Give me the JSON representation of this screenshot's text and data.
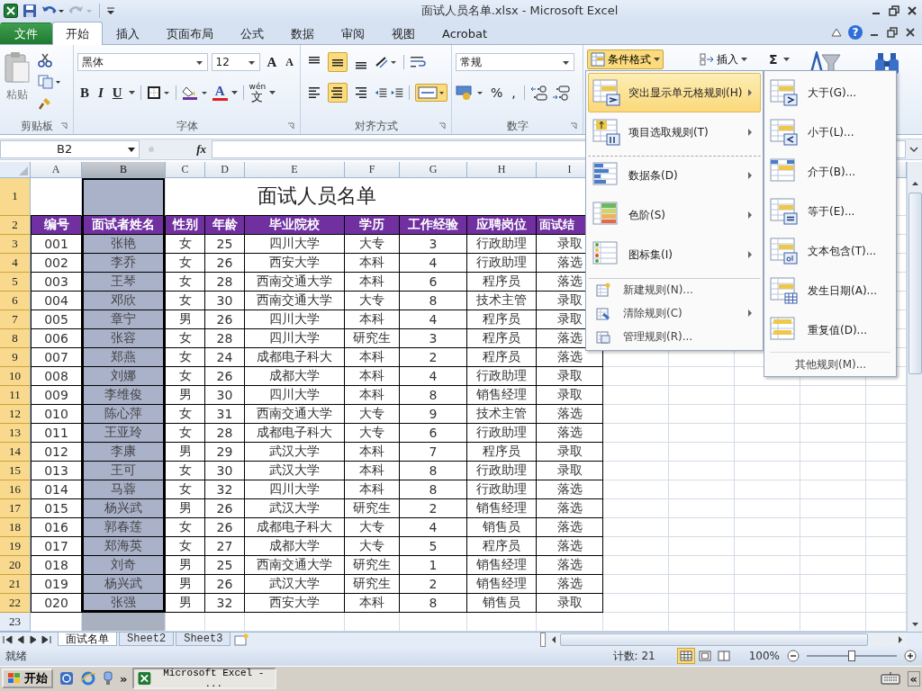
{
  "window": {
    "title": "面试人员名单.xlsx  -  Microsoft Excel"
  },
  "ribbon_tabs": [
    {
      "label": "文件",
      "kind": "file",
      "selected": false
    },
    {
      "label": "开始",
      "kind": "tab",
      "selected": true
    },
    {
      "label": "插入",
      "kind": "tab",
      "selected": false
    },
    {
      "label": "页面布局",
      "kind": "tab",
      "selected": false
    },
    {
      "label": "公式",
      "kind": "tab",
      "selected": false
    },
    {
      "label": "数据",
      "kind": "tab",
      "selected": false
    },
    {
      "label": "审阅",
      "kind": "tab",
      "selected": false
    },
    {
      "label": "视图",
      "kind": "tab",
      "selected": false
    },
    {
      "label": "Acrobat",
      "kind": "tab",
      "selected": false
    }
  ],
  "help_label": "?",
  "clipboard": {
    "paste": "粘贴",
    "group": "剪贴板"
  },
  "font": {
    "family": "黑体",
    "size": "12",
    "grow": "A",
    "shrink": "A",
    "bold": "B",
    "italic": "I",
    "underline": "U",
    "color_button": "A",
    "phonetic": "wén",
    "phonetic_char": "文",
    "group": "字体"
  },
  "alignment": {
    "group": "对齐方式",
    "vertical": [
      {
        "selected": false
      },
      {
        "selected": true
      },
      {
        "selected": false
      }
    ],
    "horizontal": [
      {
        "selected": false
      },
      {
        "selected": true
      },
      {
        "selected": false
      }
    ],
    "merge": {
      "selected": true
    }
  },
  "number": {
    "format": "常规",
    "percent": "%",
    "comma": ",",
    "group": "数字"
  },
  "cells": {
    "conditional_format": {
      "label": "条件格式",
      "pressed": true
    },
    "insert": "插入",
    "sum": "Σ"
  },
  "name_box": "B2",
  "formula_label": "fx",
  "sheet": {
    "columns": [
      {
        "label": "A",
        "selected": false
      },
      {
        "label": "B",
        "selected": true
      },
      {
        "label": "C",
        "selected": false
      },
      {
        "label": "D",
        "selected": false
      },
      {
        "label": "E",
        "selected": false
      },
      {
        "label": "F",
        "selected": false
      },
      {
        "label": "G",
        "selected": false
      },
      {
        "label": "H",
        "selected": false
      },
      {
        "label": "I",
        "selected": false
      }
    ],
    "title": "面试人员名单",
    "headers": [
      "编号",
      "面试者姓名",
      "性别",
      "年龄",
      "毕业院校",
      "学历",
      "工作经验",
      "应聘岗位",
      "面试结"
    ],
    "rows": [
      [
        "001",
        "张艳",
        "女",
        "25",
        "四川大学",
        "大专",
        "3",
        "行政助理",
        "录取"
      ],
      [
        "002",
        "李乔",
        "女",
        "26",
        "西安大学",
        "本科",
        "4",
        "行政助理",
        "落选"
      ],
      [
        "003",
        "王琴",
        "女",
        "28",
        "西南交通大学",
        "本科",
        "6",
        "程序员",
        "落选"
      ],
      [
        "004",
        "邓欣",
        "女",
        "30",
        "西南交通大学",
        "大专",
        "8",
        "技术主管",
        "录取"
      ],
      [
        "005",
        "章宁",
        "男",
        "26",
        "四川大学",
        "本科",
        "4",
        "程序员",
        "录取"
      ],
      [
        "006",
        "张容",
        "女",
        "28",
        "四川大学",
        "研究生",
        "3",
        "程序员",
        "落选"
      ],
      [
        "007",
        "郑燕",
        "女",
        "24",
        "成都电子科大",
        "本科",
        "2",
        "程序员",
        "落选"
      ],
      [
        "008",
        "刘娜",
        "女",
        "26",
        "成都大学",
        "本科",
        "4",
        "行政助理",
        "录取"
      ],
      [
        "009",
        "李维俊",
        "男",
        "30",
        "四川大学",
        "本科",
        "8",
        "销售经理",
        "录取"
      ],
      [
        "010",
        "陈心萍",
        "女",
        "31",
        "西南交通大学",
        "大专",
        "9",
        "技术主管",
        "落选"
      ],
      [
        "011",
        "王亚玲",
        "女",
        "28",
        "成都电子科大",
        "大专",
        "6",
        "行政助理",
        "落选"
      ],
      [
        "012",
        "李康",
        "男",
        "29",
        "武汉大学",
        "本科",
        "7",
        "程序员",
        "录取"
      ],
      [
        "013",
        "王可",
        "女",
        "30",
        "武汉大学",
        "本科",
        "8",
        "行政助理",
        "录取"
      ],
      [
        "014",
        "马蓉",
        "女",
        "32",
        "四川大学",
        "本科",
        "8",
        "行政助理",
        "落选"
      ],
      [
        "015",
        "杨兴武",
        "男",
        "26",
        "武汉大学",
        "研究生",
        "2",
        "销售经理",
        "落选"
      ],
      [
        "016",
        "郭春莲",
        "女",
        "26",
        "成都电子科大",
        "大专",
        "4",
        "销售员",
        "落选"
      ],
      [
        "017",
        "郑海英",
        "女",
        "27",
        "成都大学",
        "大专",
        "5",
        "程序员",
        "落选"
      ],
      [
        "018",
        "刘奇",
        "男",
        "25",
        "西南交通大学",
        "研究生",
        "1",
        "销售经理",
        "落选"
      ],
      [
        "019",
        "杨兴武",
        "男",
        "26",
        "武汉大学",
        "研究生",
        "2",
        "销售经理",
        "落选"
      ],
      [
        "020",
        "张强",
        "男",
        "32",
        "西安大学",
        "本科",
        "8",
        "销售员",
        "录取"
      ]
    ],
    "row_numbers": [
      {
        "label": "1",
        "selected": true
      },
      {
        "label": "2",
        "selected": true
      },
      {
        "label": "3",
        "selected": true
      },
      {
        "label": "4",
        "selected": true
      },
      {
        "label": "5",
        "selected": true
      },
      {
        "label": "6",
        "selected": true
      },
      {
        "label": "7",
        "selected": true
      },
      {
        "label": "8",
        "selected": true
      },
      {
        "label": "9",
        "selected": true
      },
      {
        "label": "10",
        "selected": true
      },
      {
        "label": "11",
        "selected": true
      },
      {
        "label": "12",
        "selected": true
      },
      {
        "label": "13",
        "selected": true
      },
      {
        "label": "14",
        "selected": true
      },
      {
        "label": "15",
        "selected": true
      },
      {
        "label": "16",
        "selected": true
      },
      {
        "label": "17",
        "selected": true
      },
      {
        "label": "18",
        "selected": true
      },
      {
        "label": "19",
        "selected": true
      },
      {
        "label": "20",
        "selected": true
      },
      {
        "label": "21",
        "selected": true
      },
      {
        "label": "22",
        "selected": true
      },
      {
        "label": "23",
        "selected": false
      }
    ]
  },
  "menu": {
    "items": [
      {
        "label": "突出显示单元格规则(H)",
        "kind": "large",
        "selected": true,
        "submenu": true,
        "separator": false
      },
      {
        "label": "项目选取规则(T)",
        "kind": "large",
        "selected": false,
        "submenu": true,
        "separator": false
      },
      {
        "label": "数据条(D)",
        "kind": "large",
        "selected": false,
        "submenu": true,
        "separator": true
      },
      {
        "label": "色阶(S)",
        "kind": "large",
        "selected": false,
        "submenu": true,
        "separator": false
      },
      {
        "label": "图标集(I)",
        "kind": "large",
        "selected": false,
        "submenu": true,
        "separator": false
      },
      {
        "label": "新建规则(N)...",
        "kind": "small",
        "selected": false,
        "submenu": false,
        "separator": true
      },
      {
        "label": "清除规则(C)",
        "kind": "small",
        "selected": false,
        "submenu": true,
        "separator": false
      },
      {
        "label": "管理规则(R)...",
        "kind": "small",
        "selected": false,
        "submenu": false,
        "separator": false
      }
    ]
  },
  "submenu": {
    "items": [
      "大于(G)...",
      "小于(L)...",
      "介于(B)...",
      "等于(E)...",
      "文本包含(T)...",
      "发生日期(A)...",
      "重复值(D)..."
    ],
    "more": "其他规则(M)..."
  },
  "sheet_tabs": [
    {
      "label": "面试名单",
      "selected": true
    },
    {
      "label": "Sheet2",
      "selected": false
    },
    {
      "label": "Sheet3",
      "selected": false
    }
  ],
  "status_bar": {
    "mode": "就绪",
    "count": "计数: 21",
    "zoom": "100%",
    "zoom_slider": {
      "level": 0.5
    },
    "views": [
      {
        "selected": true
      },
      {
        "selected": false
      },
      {
        "selected": false
      }
    ]
  },
  "taskbar": {
    "start": "开始",
    "more": "»",
    "window": "Microsoft Excel - ...",
    "tray_more": "«"
  }
}
